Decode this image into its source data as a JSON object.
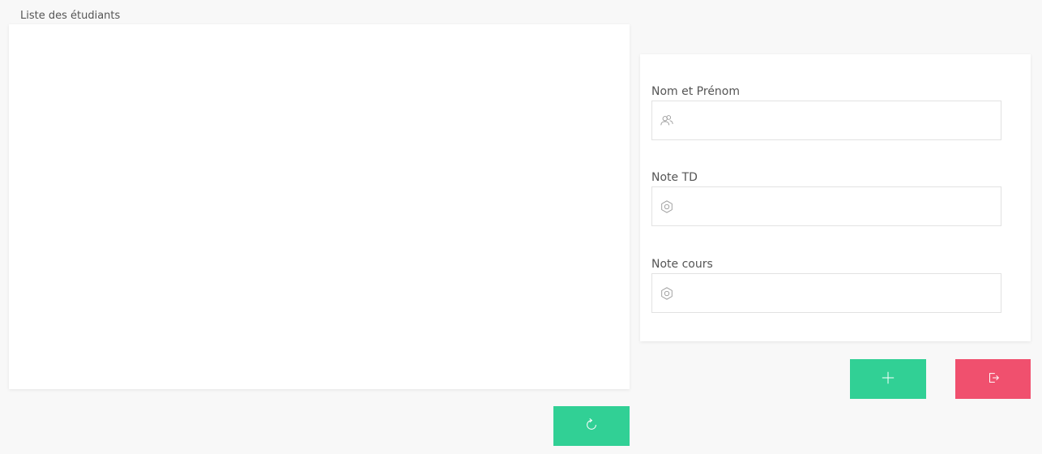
{
  "list": {
    "title": "Liste des étudiants",
    "refresh_icon": "refresh-icon"
  },
  "form": {
    "fields": [
      {
        "label": "Nom et Prénom",
        "value": "",
        "placeholder": "",
        "icon": "users-icon"
      },
      {
        "label": "Note TD",
        "value": "",
        "placeholder": "",
        "icon": "hexagon-icon"
      },
      {
        "label": "Note cours",
        "value": "",
        "placeholder": "",
        "icon": "hexagon-icon"
      }
    ]
  },
  "actions": {
    "add_icon": "plus-icon",
    "exit_icon": "sign-out-icon"
  },
  "colors": {
    "primary": "#31d095",
    "danger": "#f0506e",
    "panel": "#ffffff",
    "background": "#f8f8f8"
  }
}
